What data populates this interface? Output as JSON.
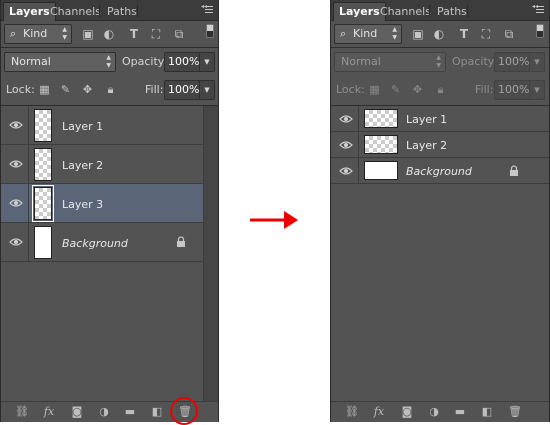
{
  "tabs": [
    "Layers",
    "Channels",
    "Paths"
  ],
  "filter": {
    "kind_label": "Kind",
    "search_icon": "search-icon"
  },
  "blend_mode": "Normal",
  "opacity": {
    "label": "Opacity:",
    "value": "100%"
  },
  "lock": {
    "label": "Lock:"
  },
  "fill": {
    "label": "Fill:",
    "value": "100%"
  },
  "before": {
    "layers": [
      {
        "name": "Layer 1",
        "transparent": true,
        "selected": false,
        "locked": false
      },
      {
        "name": "Layer 2",
        "transparent": true,
        "selected": false,
        "locked": false
      },
      {
        "name": "Layer 3",
        "transparent": true,
        "selected": true,
        "locked": false
      },
      {
        "name": "Background",
        "transparent": false,
        "selected": false,
        "locked": true,
        "italic": true
      }
    ]
  },
  "after": {
    "layers": [
      {
        "name": "Layer 1",
        "transparent": true,
        "selected": false,
        "locked": false
      },
      {
        "name": "Layer 2",
        "transparent": true,
        "selected": false,
        "locked": false
      },
      {
        "name": "Background",
        "transparent": false,
        "selected": false,
        "locked": true,
        "italic": true
      }
    ]
  },
  "footer_icons": [
    "link-icon",
    "fx-icon",
    "mask-icon",
    "adjustment-icon",
    "folder-icon",
    "new-layer-icon",
    "trash-icon"
  ],
  "fx_label": "fx",
  "colors": {
    "panel": "#535353",
    "selected": "#5a6577",
    "highlight": "#ee0000"
  }
}
